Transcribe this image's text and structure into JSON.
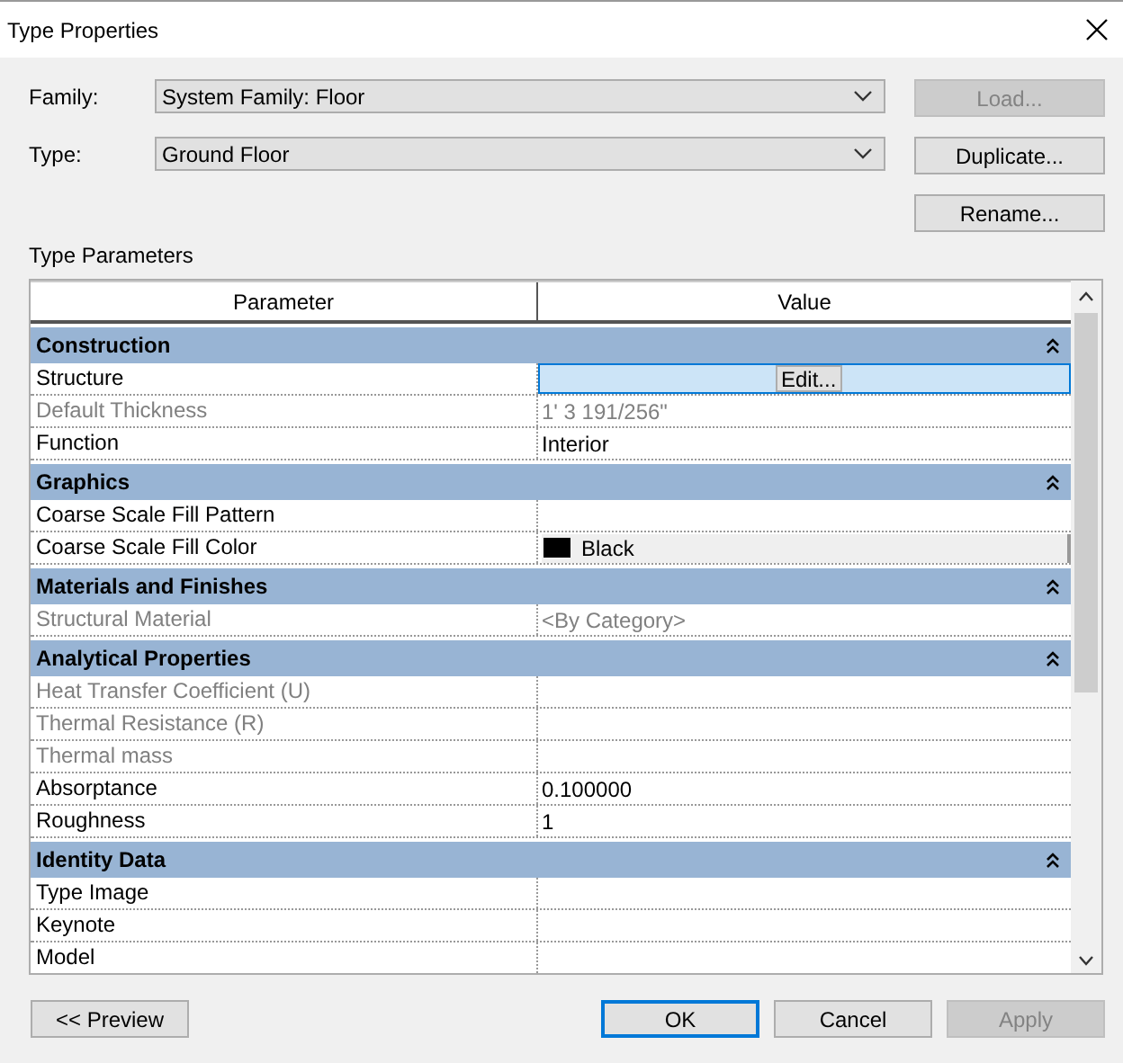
{
  "window": {
    "title": "Type Properties"
  },
  "fields": [
    {
      "label": "Family:",
      "value": "System Family: Floor"
    },
    {
      "label": "Type:",
      "value": "Ground Floor"
    }
  ],
  "side_buttons": [
    {
      "label": "Load...",
      "disabled": true
    },
    {
      "label": "Duplicate...",
      "disabled": false
    },
    {
      "label": "Rename...",
      "disabled": false
    }
  ],
  "section_title": "Type Parameters",
  "table": {
    "columns": [
      "Parameter",
      "Value"
    ],
    "rows": [
      {
        "kind": "group",
        "name": "Construction"
      },
      {
        "kind": "button",
        "name": "Structure",
        "value": "Edit...",
        "disabled": false,
        "selected": true
      },
      {
        "kind": "text",
        "name": "Default Thickness",
        "value": "1'  3 191/256\"",
        "disabled": true,
        "selected": false
      },
      {
        "kind": "text",
        "name": "Function",
        "value": "Interior",
        "disabled": false,
        "selected": false
      },
      {
        "kind": "group",
        "name": "Graphics"
      },
      {
        "kind": "text",
        "name": "Coarse Scale Fill Pattern",
        "value": "",
        "disabled": false,
        "selected": false
      },
      {
        "kind": "swatch",
        "name": "Coarse Scale Fill Color",
        "value": "Black",
        "color": "#000000",
        "disabled": false,
        "selected": false
      },
      {
        "kind": "group",
        "name": "Materials and Finishes"
      },
      {
        "kind": "text",
        "name": "Structural Material",
        "value": "<By Category>",
        "disabled": true,
        "selected": false
      },
      {
        "kind": "group",
        "name": "Analytical Properties"
      },
      {
        "kind": "text",
        "name": "Heat Transfer Coefficient (U)",
        "value": "",
        "disabled": true,
        "selected": false
      },
      {
        "kind": "text",
        "name": "Thermal Resistance (R)",
        "value": "",
        "disabled": true,
        "selected": false
      },
      {
        "kind": "text",
        "name": "Thermal mass",
        "value": "",
        "disabled": true,
        "selected": false
      },
      {
        "kind": "text",
        "name": "Absorptance",
        "value": "0.100000",
        "disabled": false,
        "selected": false
      },
      {
        "kind": "text",
        "name": "Roughness",
        "value": "1",
        "disabled": false,
        "selected": false
      },
      {
        "kind": "group",
        "name": "Identity Data"
      },
      {
        "kind": "text",
        "name": "Type Image",
        "value": "",
        "disabled": false,
        "selected": false
      },
      {
        "kind": "text",
        "name": "Keynote",
        "value": "",
        "disabled": false,
        "selected": false
      },
      {
        "kind": "text",
        "name": "Model",
        "value": "",
        "disabled": false,
        "selected": false
      }
    ]
  },
  "footer_buttons": [
    {
      "label": "<< Preview",
      "kind": "preview",
      "disabled": false,
      "default": false
    },
    {
      "label": "OK",
      "kind": "action",
      "disabled": false,
      "default": true
    },
    {
      "label": "Cancel",
      "kind": "action",
      "disabled": false,
      "default": false
    },
    {
      "label": "Apply",
      "kind": "action",
      "disabled": true,
      "default": false
    }
  ]
}
